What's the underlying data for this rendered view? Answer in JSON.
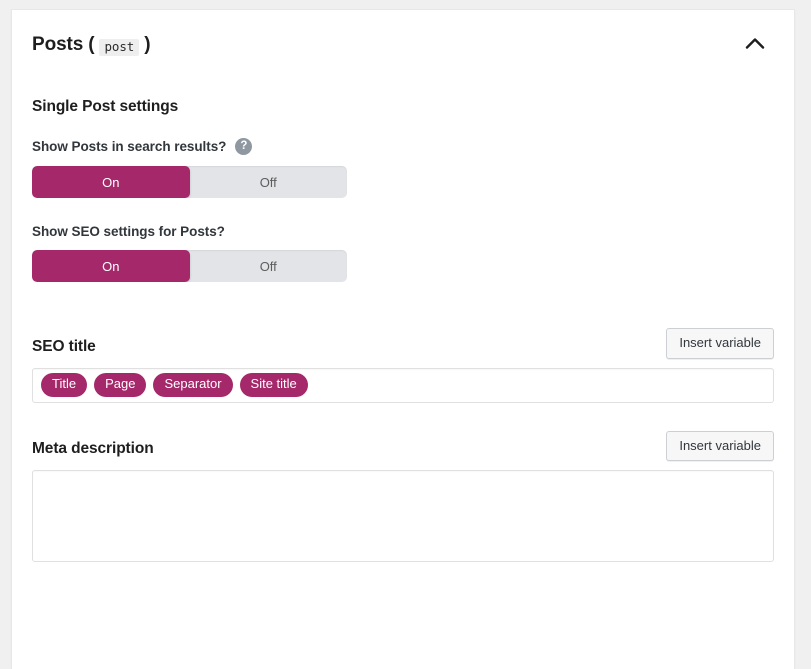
{
  "panel": {
    "title_prefix": "Posts",
    "paren_open": "(",
    "post_type_slug": "post",
    "paren_close": ")",
    "collapse_icon": "chevron-up-icon",
    "collapsed": false
  },
  "section": {
    "heading": "Single Post settings"
  },
  "fields": {
    "show_in_search": {
      "label": "Show Posts in search results?",
      "help_icon": "help-circle-icon",
      "help_glyph": "?",
      "options": [
        "On",
        "Off"
      ],
      "value": "On"
    },
    "show_seo_settings": {
      "label": "Show SEO settings for Posts?",
      "options": [
        "On",
        "Off"
      ],
      "value": "On"
    },
    "seo_title": {
      "label": "SEO title",
      "insert_variable_label": "Insert variable",
      "tokens": [
        "Title",
        "Page",
        "Separator",
        "Site title"
      ],
      "value": ""
    },
    "meta_description": {
      "label": "Meta description",
      "insert_variable_label": "Insert variable",
      "value": "",
      "placeholder": ""
    }
  },
  "colors": {
    "accent": "#a4286a",
    "toggle_track": "#e2e4e7",
    "card_bg": "#ffffff",
    "page_bg": "#f0f0f0",
    "text": "#1e1e1e",
    "label_text": "#32373c",
    "help_icon_bg": "#8f98a1"
  }
}
